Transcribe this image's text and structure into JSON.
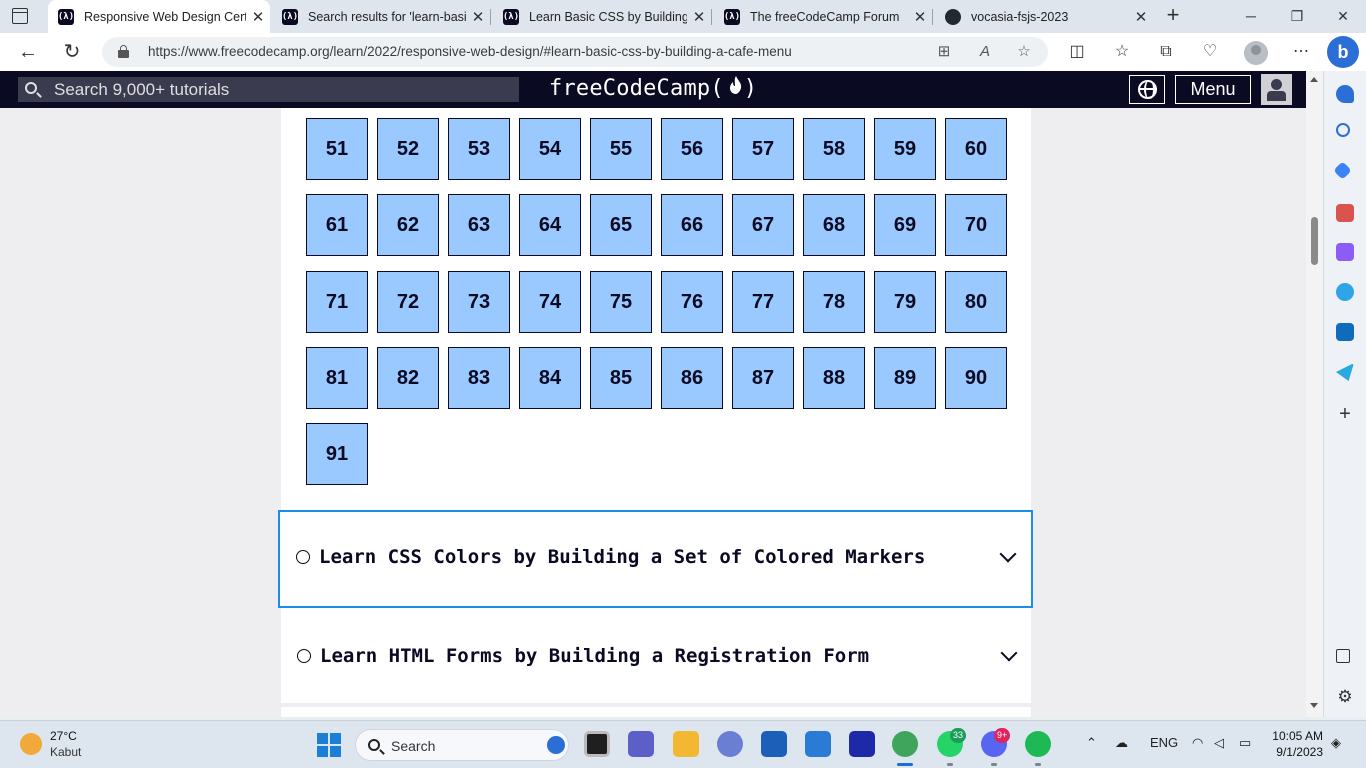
{
  "browser": {
    "tabs": [
      {
        "label": "Responsive Web Design Certi",
        "favicon": "fcc",
        "active": true
      },
      {
        "label": "Search results for 'learn-basic",
        "favicon": "fcc",
        "active": false
      },
      {
        "label": "Learn Basic CSS by Building a",
        "favicon": "fcc",
        "active": false
      },
      {
        "label": "The freeCodeCamp Forum",
        "favicon": "fcc",
        "active": false
      },
      {
        "label": "vocasia-fsjs-2023",
        "favicon": "github",
        "active": false
      }
    ],
    "url": "https://www.freecodecamp.org/learn/2022/responsive-web-design/#learn-basic-css-by-building-a-cafe-menu",
    "icons": {
      "back": "←",
      "refresh": "↻",
      "new_tab": "+",
      "minimize": "─",
      "maximize": "❐",
      "close": "✕",
      "tab_close": "✕",
      "app_view": "⊞",
      "read_aloud": "A",
      "favorite": "☆",
      "split": "◫",
      "favorites": "☆",
      "collections": "⧉",
      "performance": "♡",
      "more": "⋯"
    }
  },
  "fcc": {
    "search_placeholder": "Search 9,000+ tutorials",
    "logo_text": "freeCodeCamp(",
    "logo_flame": "🔥",
    "logo_close": ")",
    "menu_label": "Menu",
    "steps": [
      "51",
      "52",
      "53",
      "54",
      "55",
      "56",
      "57",
      "58",
      "59",
      "60",
      "61",
      "62",
      "63",
      "64",
      "65",
      "66",
      "67",
      "68",
      "69",
      "70",
      "71",
      "72",
      "73",
      "74",
      "75",
      "76",
      "77",
      "78",
      "79",
      "80",
      "81",
      "82",
      "83",
      "84",
      "85",
      "86",
      "87",
      "88",
      "89",
      "90",
      "91"
    ],
    "blocks": [
      {
        "title": "Learn CSS Colors by Building a Set of Colored Markers",
        "focused": true
      },
      {
        "title": "Learn HTML Forms by Building a Registration Form",
        "focused": false
      }
    ],
    "colors": {
      "nav_bg": "#0a0a23",
      "step_bg": "#99c9ff",
      "focus": "#198eee"
    }
  },
  "taskbar": {
    "weather": {
      "temp": "27°C",
      "desc": "Kabut"
    },
    "search_label": "Search",
    "badges": {
      "whatsapp": "33",
      "discord": "9+"
    },
    "language": "ENG",
    "time": "10:05 AM",
    "date": "9/1/2023"
  }
}
